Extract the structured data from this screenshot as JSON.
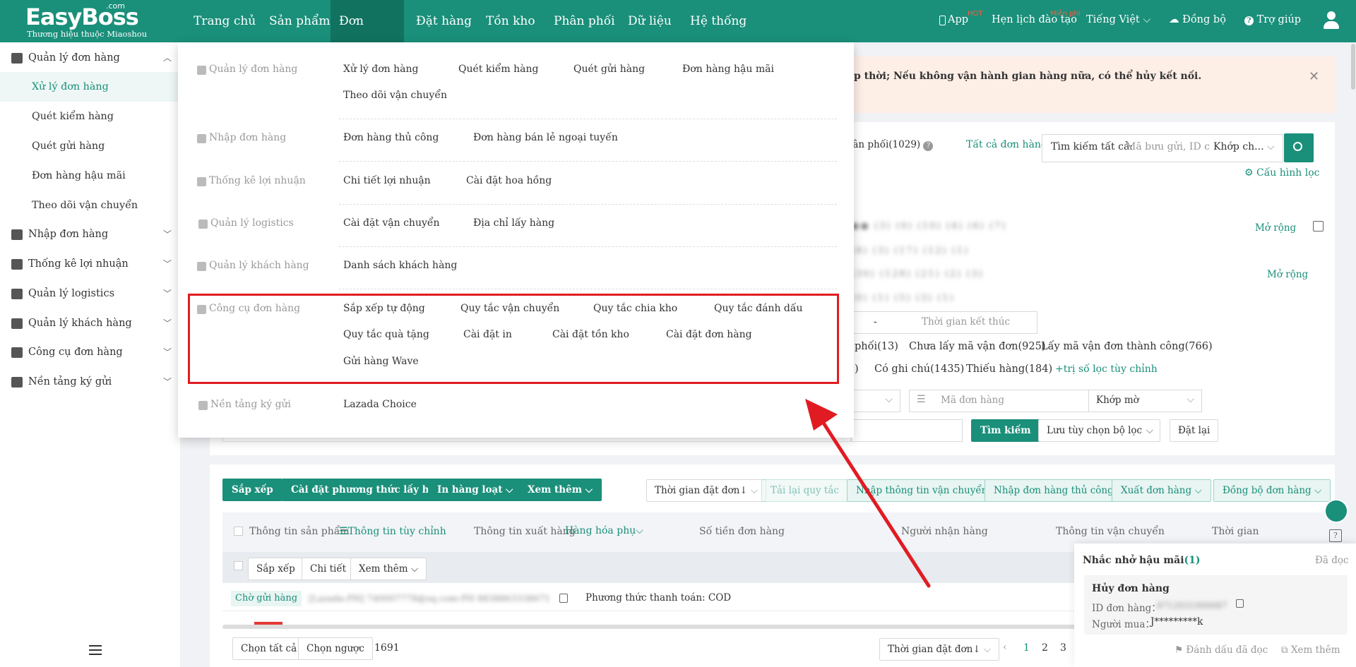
{
  "app": {
    "logo": "EasyBoss",
    "logo_com": ".com",
    "logo_sub": "Thương hiệu thuộc Miaoshou"
  },
  "topnav": {
    "items": [
      "Trang chủ",
      "Sản phẩm",
      "Đơn hàng",
      "Đặt hàng",
      "Tồn kho",
      "Phân phối",
      "Dữ liệu",
      "Hệ thống"
    ],
    "active": "Đơn hàng",
    "app_label": "App",
    "app_badge": "HOT",
    "training_label": "Hẹn lịch đào tạo",
    "training_badge": "Miễn phí",
    "language": "Tiếng Việt",
    "sync": "Đồng bộ",
    "help": "Trợ giúp"
  },
  "sidebar": {
    "items": [
      {
        "label": "Quản lý đơn hàng",
        "type": "group",
        "icon": "order-manage-icon",
        "expanded": true
      },
      {
        "label": "Xử lý đơn hàng",
        "type": "sub",
        "active": true
      },
      {
        "label": "Quét kiểm hàng",
        "type": "sub"
      },
      {
        "label": "Quét gửi hàng",
        "type": "sub"
      },
      {
        "label": "Đơn hàng hậu mãi",
        "type": "sub"
      },
      {
        "label": "Theo dõi vận chuyển",
        "type": "sub"
      },
      {
        "label": "Nhập đơn hàng",
        "type": "group",
        "icon": "import-order-icon"
      },
      {
        "label": "Thống kê lợi nhuận",
        "type": "group",
        "icon": "profit-stats-icon"
      },
      {
        "label": "Quản lý logistics",
        "type": "group",
        "icon": "truck-icon"
      },
      {
        "label": "Quản lý khách hàng",
        "type": "group",
        "icon": "customer-icon"
      },
      {
        "label": "Công cụ đơn hàng",
        "type": "group",
        "icon": "order-tools-icon"
      },
      {
        "label": "Nền tảng ký gửi",
        "type": "group",
        "icon": "consignment-icon"
      }
    ]
  },
  "mega_menu": {
    "sections": [
      {
        "title": "Quản lý đơn hàng",
        "rows": [
          [
            "Xử lý đơn hàng",
            "Quét kiểm hàng",
            "Quét gửi hàng",
            "Đơn hàng hậu mãi"
          ],
          [
            "Theo dõi vận chuyển"
          ]
        ]
      },
      {
        "title": "Nhập đơn hàng",
        "rows": [
          [
            "Đơn hàng thủ công",
            "Đơn hàng bán lẻ ngoại tuyến"
          ]
        ]
      },
      {
        "title": "Thống kê lợi nhuận",
        "rows": [
          [
            "Chi tiết lợi nhuận",
            "Cài đặt hoa hồng"
          ]
        ]
      },
      {
        "title": "Quản lý logistics",
        "rows": [
          [
            "Cài đặt vận chuyển",
            "Địa chỉ lấy hàng"
          ]
        ]
      },
      {
        "title": "Quản lý khách hàng",
        "rows": [
          [
            "Danh sách khách hàng"
          ]
        ]
      },
      {
        "title": "Công cụ đơn hàng",
        "rows": [
          [
            "Sắp xếp tự động",
            "Quy tắc vận chuyển",
            "Quy tắc chia kho",
            "Quy tắc đánh dấu"
          ],
          [
            "Quy tắc quà tặng",
            "Cài đặt in",
            "Cài đặt tồn kho",
            "Cài đặt đơn hàng"
          ],
          [
            "Gửi hàng Wave"
          ]
        ]
      },
      {
        "title": "Nền tảng ký gửi",
        "rows": [
          [
            "Lazada Choice"
          ]
        ]
      }
    ]
  },
  "banner": {
    "text": "p thời; Nếu không vận hành gian hàng nữa, có thể hủy kết nối."
  },
  "filters": {
    "distribution": "phân phối(1029)",
    "all_orders": "Tất cả đơn hàng",
    "search_all": "Tìm kiếm tất cả:",
    "search_placeholder": "Mã bưu gửi, ID c",
    "match": "Khớp ch...",
    "config": "Cấu hình lọc",
    "expand1": "Mở rộng",
    "expand2": "Mở rộng",
    "end_time": "Thời gian kết thúc",
    "dash": "-",
    "status_row1": [
      "phối(13)",
      "Chưa lấy mã vận đơn(925)",
      "Lấy mã vận đơn thành công(766)"
    ],
    "status_row2": [
      ")",
      "Có ghi chú(1435)",
      "Thiếu hàng(184)"
    ],
    "custom_filter": "+trị số lọc tùy chỉnh",
    "order_code_placeholder": "Mã đơn hàng",
    "fuzzy": "Khớp mờ",
    "search_btn": "Tìm kiếm",
    "save_filter": "Lưu tùy chọn bộ lọc",
    "reset": "Đặt lại"
  },
  "toolbar": {
    "sort": "Sắp xếp",
    "pickup_method": "Cài đặt phương thức lấy hàng",
    "batch_print": "In hàng loạt",
    "more": "Xem thêm",
    "order_time": "Thời gian đặt đơn↓",
    "reload_rules": "Tải lại quy tắc",
    "import_shipping": "Nhập thông tin vận chuyển",
    "import_manual": "Nhập đơn hàng thủ công",
    "export": "Xuất đơn hàng",
    "sync_orders": "Đồng bộ đơn hàng"
  },
  "table": {
    "headers": [
      "Thông tin sản phẩm",
      "Thông tin tùy chỉnh",
      "Thông tin xuất hàng",
      "Hàng hóa phụ",
      "Số tiền đơn hàng",
      "Người nhận hàng",
      "Thông tin vận chuyển",
      "Thời gian"
    ],
    "subbar": [
      "Sắp xếp",
      "Chi tiết",
      "Xem thêm"
    ],
    "row_status": "Chờ gửi hàng",
    "payment": "Phương thức thanh toán: COD"
  },
  "footer": {
    "select_all": "Chọn tất cả",
    "invert": "Chọn ngược",
    "count": "1691",
    "sort": "Thời gian đặt đơn↓",
    "pages": [
      "1",
      "2",
      "3"
    ]
  },
  "notification": {
    "title": "Nhắc nhở hậu mãi",
    "count": "(1)",
    "read": "Đã đọc",
    "card_title": "Hủy đơn hàng",
    "order_id_label": "ID đơn hàng：",
    "buyer_label": "Người mua：",
    "buyer_value": "J*********k",
    "mark_read": "Đánh dấu đã đọc",
    "view_more": "Xem thêm"
  },
  "colors": {
    "brand": "#1a8f7a",
    "highlight": "#e11b22",
    "banner_bg": "#fdeee6"
  }
}
